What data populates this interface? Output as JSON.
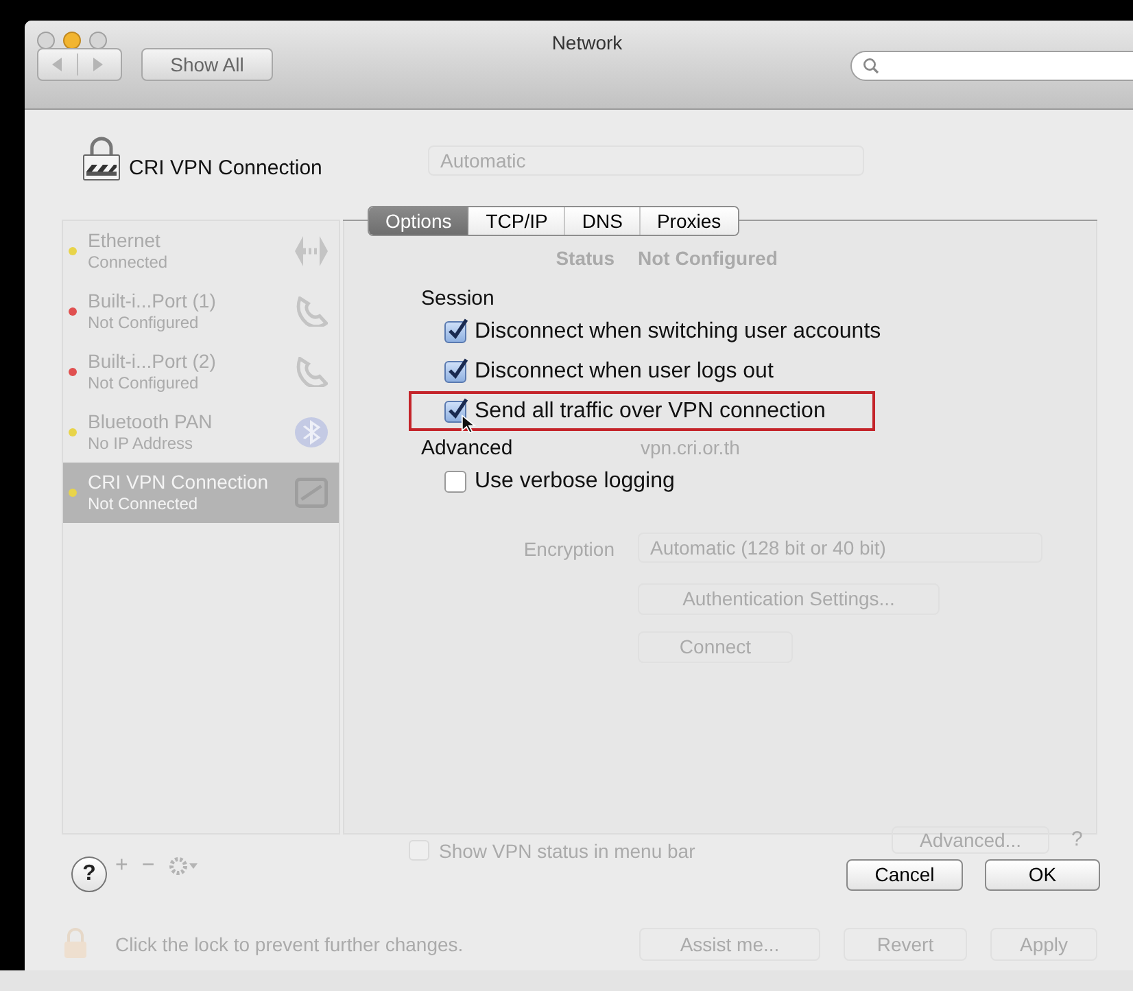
{
  "window": {
    "title": "Network"
  },
  "toolbar": {
    "show_all": "Show All"
  },
  "background": {
    "location": "Automatic",
    "services": [
      {
        "name": "Ethernet",
        "status": "Connected",
        "color": "#e8d44a",
        "kind": "ethernet",
        "selected": false
      },
      {
        "name": "Built-i...Port (1)",
        "status": "Not Configured",
        "color": "#e05050",
        "kind": "phone",
        "selected": false
      },
      {
        "name": "Built-i...Port (2)",
        "status": "Not Configured",
        "color": "#e05050",
        "kind": "phone",
        "selected": false
      },
      {
        "name": "Bluetooth PAN",
        "status": "No IP Address",
        "color": "#e8d44a",
        "kind": "bluetooth",
        "selected": false
      },
      {
        "name": "CRI VPN Connection",
        "status": "Not Connected",
        "color": "#e8d44a",
        "kind": "vpn",
        "selected": true
      }
    ],
    "sidebar_actions": [
      "+",
      "−"
    ],
    "status_label": "Status",
    "status_value": "Not Configured",
    "server_address": "vpn.cri.or.th",
    "encryption_label": "Encryption",
    "encryption": "Automatic (128 bit or 40 bit)",
    "buttons": [
      "Authentication Settings...",
      "Connect"
    ],
    "show_status": {
      "label": "Show VPN status in menu bar",
      "checked": false
    },
    "advanced": "Advanced...",
    "help": "?",
    "lock_text": "Click the lock to prevent further changes.",
    "footer_buttons": [
      "Assist me...",
      "Revert",
      "Apply"
    ]
  },
  "sheet": {
    "title": "CRI VPN Connection",
    "tabs": [
      {
        "label": "Options",
        "selected": true
      },
      {
        "label": "TCP/IP",
        "selected": false
      },
      {
        "label": "DNS",
        "selected": false
      },
      {
        "label": "Proxies",
        "selected": false
      }
    ],
    "sections": [
      {
        "heading": "Session",
        "options": [
          {
            "label": "Disconnect when switching user accounts",
            "checked": true,
            "highlighted": false
          },
          {
            "label": "Disconnect when user logs out",
            "checked": true,
            "highlighted": false
          },
          {
            "label": "Send all traffic over VPN connection",
            "checked": true,
            "highlighted": true
          }
        ]
      },
      {
        "heading": "Advanced",
        "options": [
          {
            "label": "Use verbose logging",
            "checked": false,
            "highlighted": false
          }
        ]
      }
    ],
    "help": "?",
    "buttons": [
      "Cancel",
      "OK"
    ]
  }
}
